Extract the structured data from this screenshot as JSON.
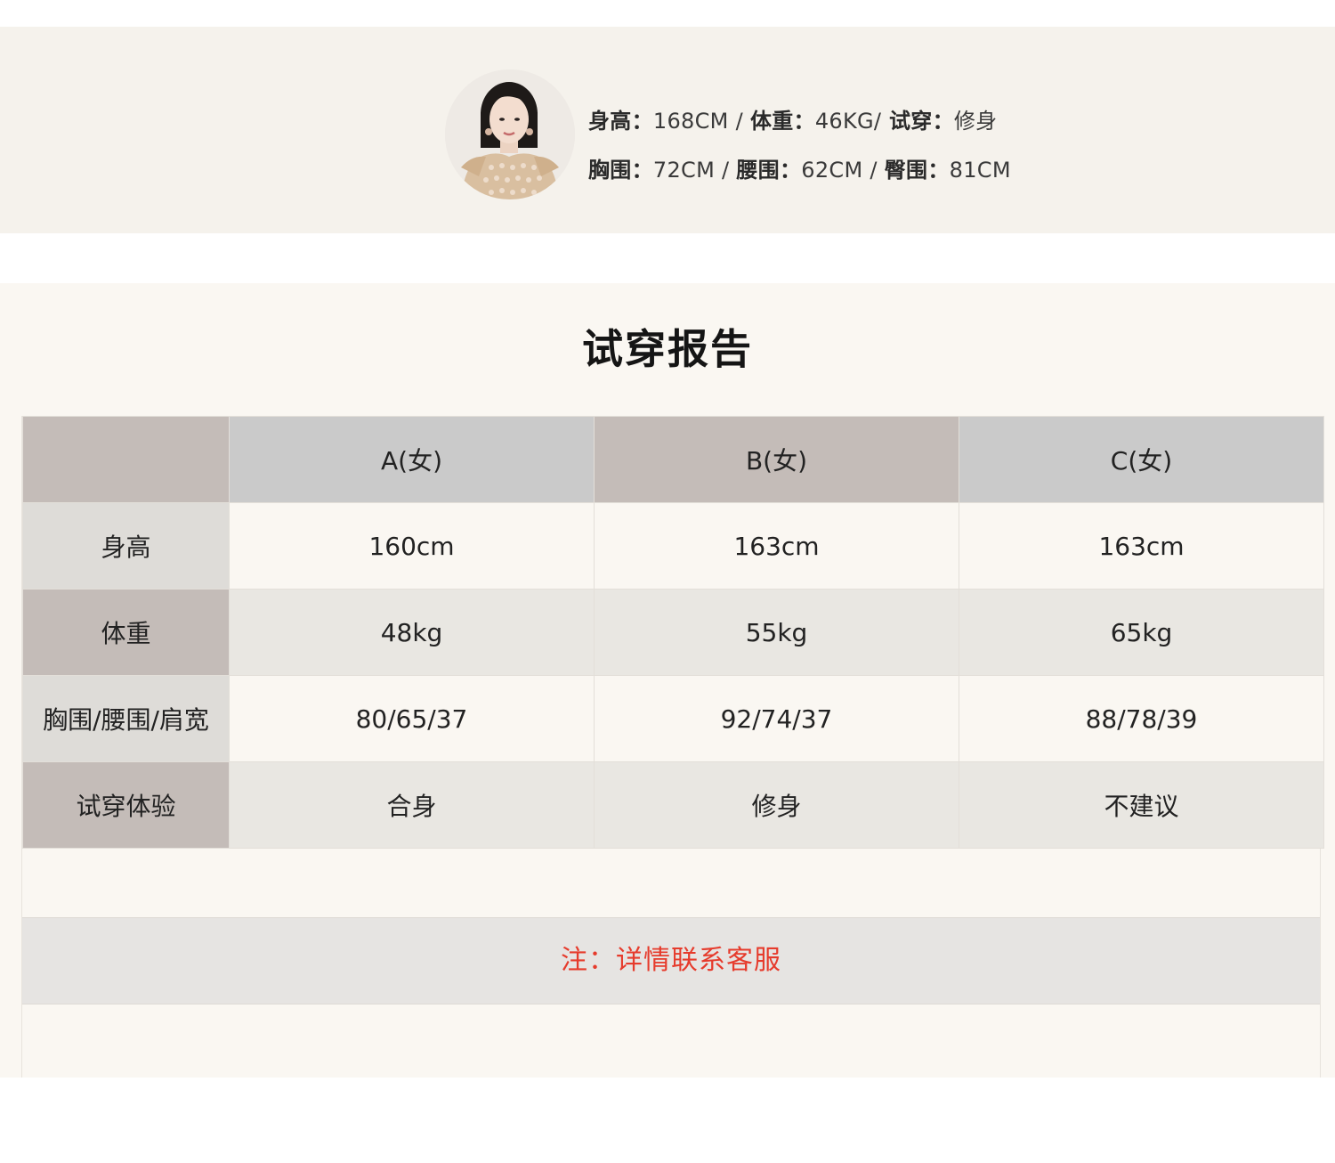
{
  "model": {
    "height_label": "身高：",
    "height_value": "168CM",
    "sep1": " / ",
    "weight_label": "体重：",
    "weight_value": "46KG/",
    "fit_label": " 试穿：",
    "fit_value": "修身",
    "bust_label": "胸围：",
    "bust_value": "72CM",
    "sep2": " / ",
    "waist_label": "腰围：",
    "waist_value": "62CM",
    "sep3": " / ",
    "hip_label": "臀围：",
    "hip_value": "81CM"
  },
  "report": {
    "title": "试穿报告",
    "columns": [
      "",
      "A(女)",
      "B(女)",
      "C(女)"
    ],
    "rows": [
      {
        "label": "身高",
        "values": [
          "160cm",
          "163cm",
          "163cm"
        ]
      },
      {
        "label": "体重",
        "values": [
          "48kg",
          "55kg",
          "65kg"
        ]
      },
      {
        "label": "胸围/腰围/肩宽",
        "values": [
          "80/65/37",
          "92/74/37",
          "88/78/39"
        ]
      },
      {
        "label": "试穿体验",
        "values": [
          "合身",
          "修身",
          "不建议"
        ]
      }
    ],
    "note": "注：详情联系客服"
  },
  "colors": {
    "note_text": "#e63b2c",
    "header_gray": "#cacaca",
    "header_taupe": "#c4bcb8",
    "band_bg": "#f5f2ec"
  }
}
